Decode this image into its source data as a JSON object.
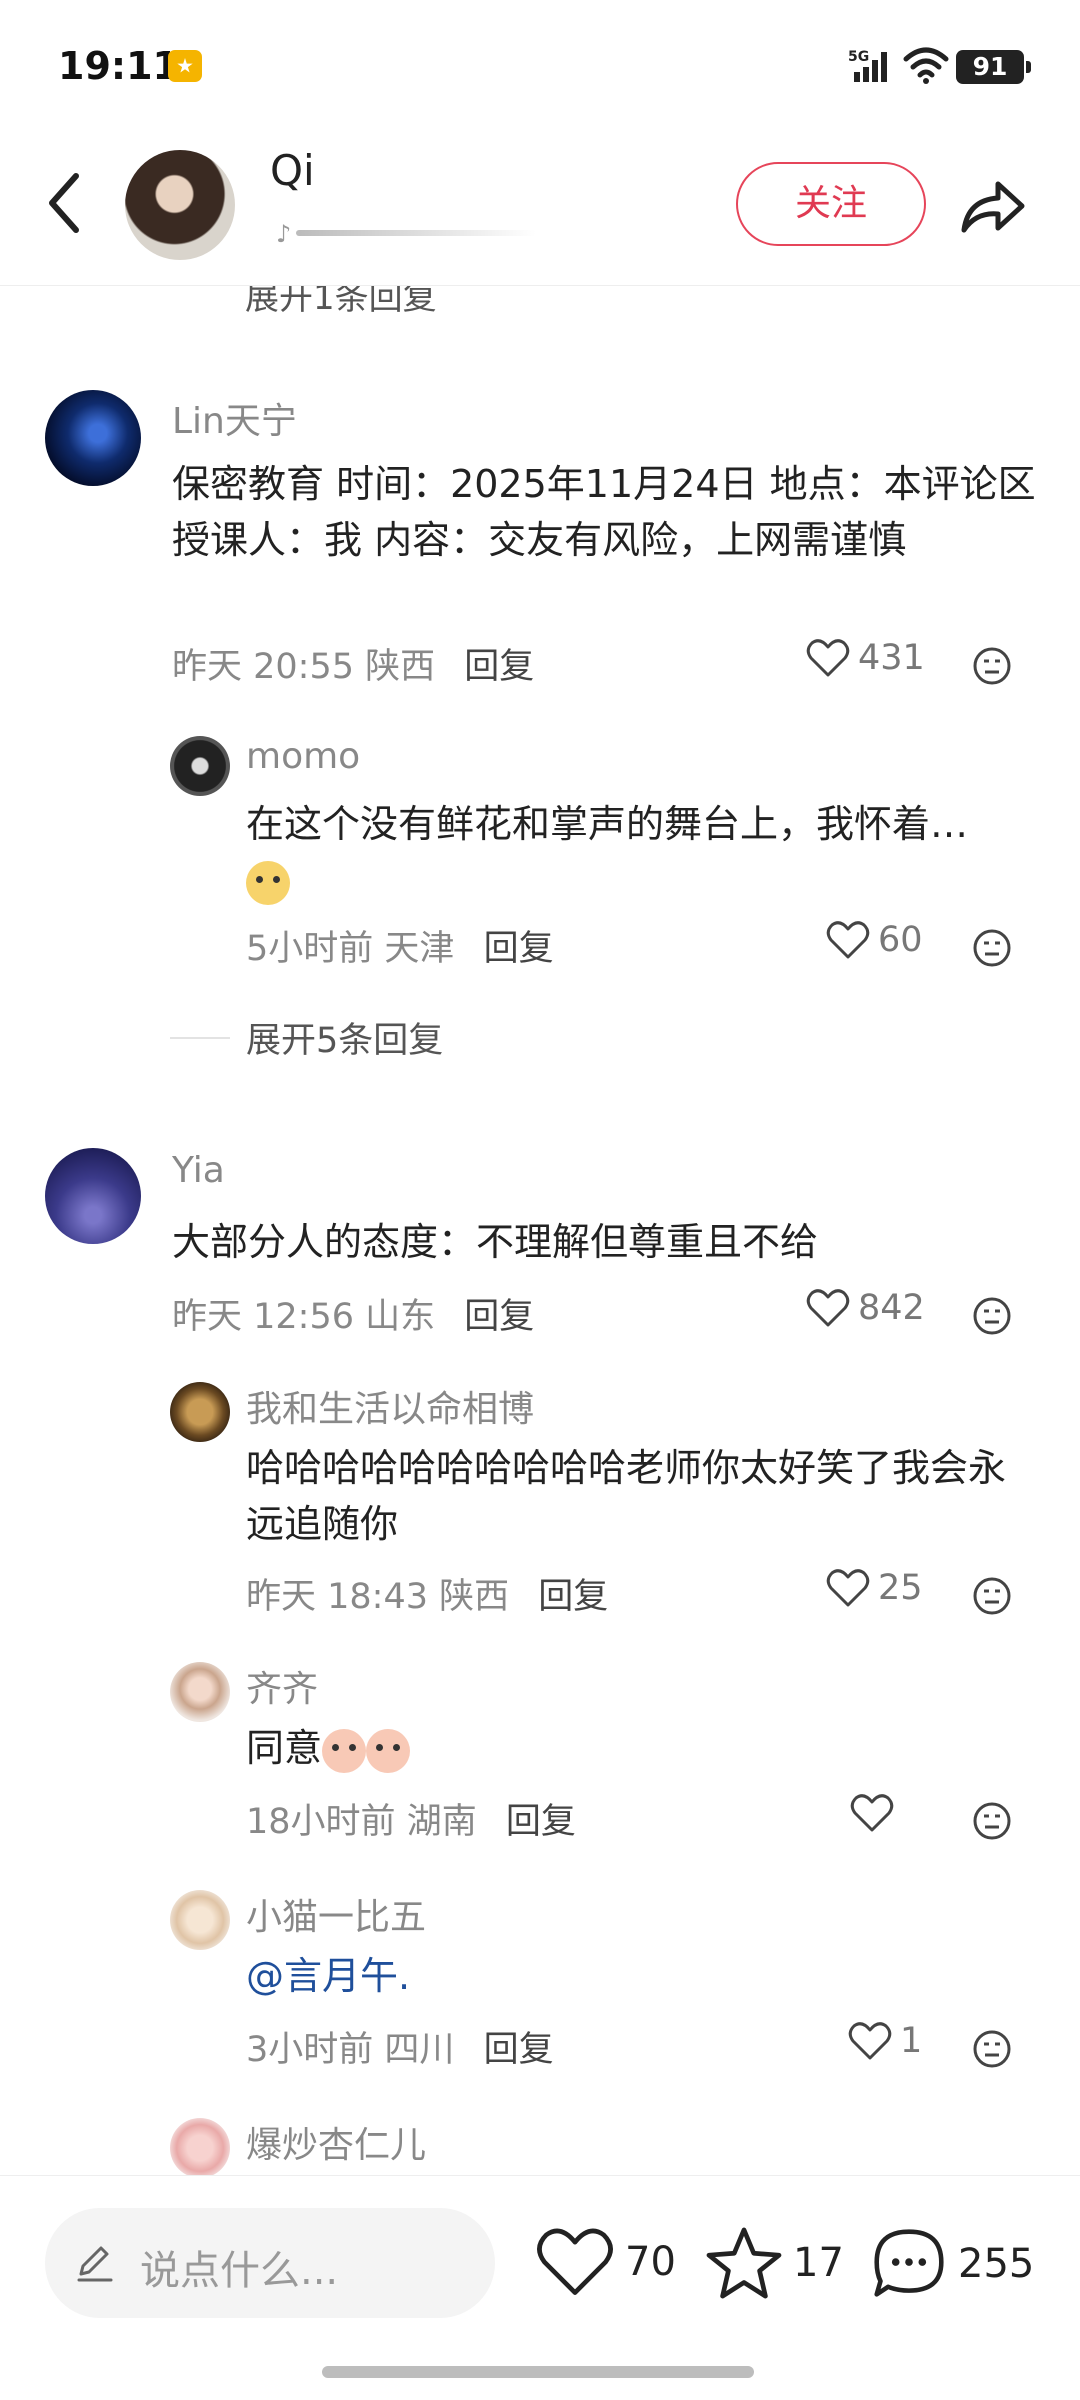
{
  "status_bar": {
    "time": "19:11",
    "network": "5G",
    "battery": "91"
  },
  "header": {
    "name": "Qi",
    "follow_label": "关注"
  },
  "clipped_reply_text": "展开1条回复",
  "comments": [
    {
      "user": "Lin天宁",
      "text": "保密教育  时间：2025年11月24日  地点：本评论区 授课人：我  内容：交友有风险，上网需谨慎",
      "time": "昨天 20:55",
      "location": "陕西",
      "reply_label": "回复",
      "likes": "431",
      "replies": [
        {
          "user": "momo",
          "text": "在这个没有鲜花和掌声的舞台上，我怀着…",
          "time": "5小时前",
          "location": "天津",
          "reply_label": "回复",
          "likes": "60"
        }
      ],
      "expand_label": "展开5条回复"
    },
    {
      "user": "Yia",
      "text": "大部分人的态度：不理解但尊重且不给",
      "time": "昨天 12:56",
      "location": "山东",
      "reply_label": "回复",
      "likes": "842",
      "replies": [
        {
          "user": "我和生活以命相博",
          "text": "哈哈哈哈哈哈哈哈哈哈老师你太好笑了我会永远追随你",
          "time": "昨天 18:43",
          "location": "陕西",
          "reply_label": "回复",
          "likes": "25"
        },
        {
          "user": "齐齐",
          "text": "同意",
          "time": "18小时前",
          "location": "湖南",
          "reply_label": "回复",
          "likes": ""
        },
        {
          "user": "小猫一比五",
          "text": "@言月午.",
          "time": "3小时前",
          "location": "四川",
          "reply_label": "回复",
          "likes": "1"
        },
        {
          "user": "爆炒杏仁儿"
        }
      ]
    }
  ],
  "bottom_bar": {
    "input_placeholder": "说点什么...",
    "like_count": "70",
    "fav_count": "17",
    "comment_count": "255"
  },
  "colors": {
    "accent": "#e03a52",
    "mention": "#1f4f9b",
    "secondary_text": "#888888"
  },
  "icons": [
    "back-arrow-icon",
    "share-icon",
    "heart-icon",
    "dislike-face-icon",
    "star-icon",
    "chat-bubble-icon",
    "pencil-icon"
  ]
}
